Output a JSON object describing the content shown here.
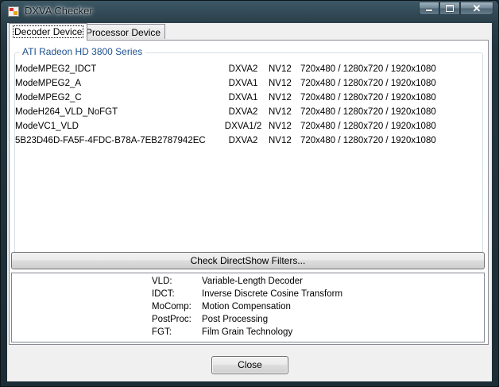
{
  "window": {
    "title": "DXVA Checker"
  },
  "tabs": [
    {
      "label": "Decoder Device",
      "active": true
    },
    {
      "label": "Processor Device",
      "active": false
    }
  ],
  "decoder": {
    "group_title": "ATI Radeon HD 3800 Series",
    "rows": [
      {
        "name": "ModeMPEG2_IDCT",
        "version": "DXVA2",
        "format": "NV12",
        "resolutions": "720x480 / 1280x720 / 1920x1080"
      },
      {
        "name": "ModeMPEG2_A",
        "version": "DXVA1",
        "format": "NV12",
        "resolutions": "720x480 / 1280x720 / 1920x1080"
      },
      {
        "name": "ModeMPEG2_C",
        "version": "DXVA1",
        "format": "NV12",
        "resolutions": "720x480 / 1280x720 / 1920x1080"
      },
      {
        "name": "ModeH264_VLD_NoFGT",
        "version": "DXVA2",
        "format": "NV12",
        "resolutions": "720x480 / 1280x720 / 1920x1080"
      },
      {
        "name": "ModeVC1_VLD",
        "version": "DXVA1/2",
        "format": "NV12",
        "resolutions": "720x480 / 1280x720 / 1920x1080"
      },
      {
        "name": "5B23D46D-FA5F-4FDC-B78A-7EB2787942EC",
        "version": "DXVA2",
        "format": "NV12",
        "resolutions": "720x480 / 1280x720 / 1920x1080"
      }
    ]
  },
  "buttons": {
    "check_filters": "Check DirectShow Filters...",
    "close": "Close"
  },
  "glossary": [
    {
      "abbr": "VLD:",
      "definition": "Variable-Length Decoder"
    },
    {
      "abbr": "IDCT:",
      "definition": "Inverse Discrete Cosine Transform"
    },
    {
      "abbr": "MoComp:",
      "definition": "Motion Compensation"
    },
    {
      "abbr": "PostProc:",
      "definition": "Post Processing"
    },
    {
      "abbr": "FGT:",
      "definition": "Film Grain Technology"
    }
  ],
  "icons": [
    "app-icon",
    "minimize-icon",
    "maximize-icon",
    "close-icon"
  ]
}
